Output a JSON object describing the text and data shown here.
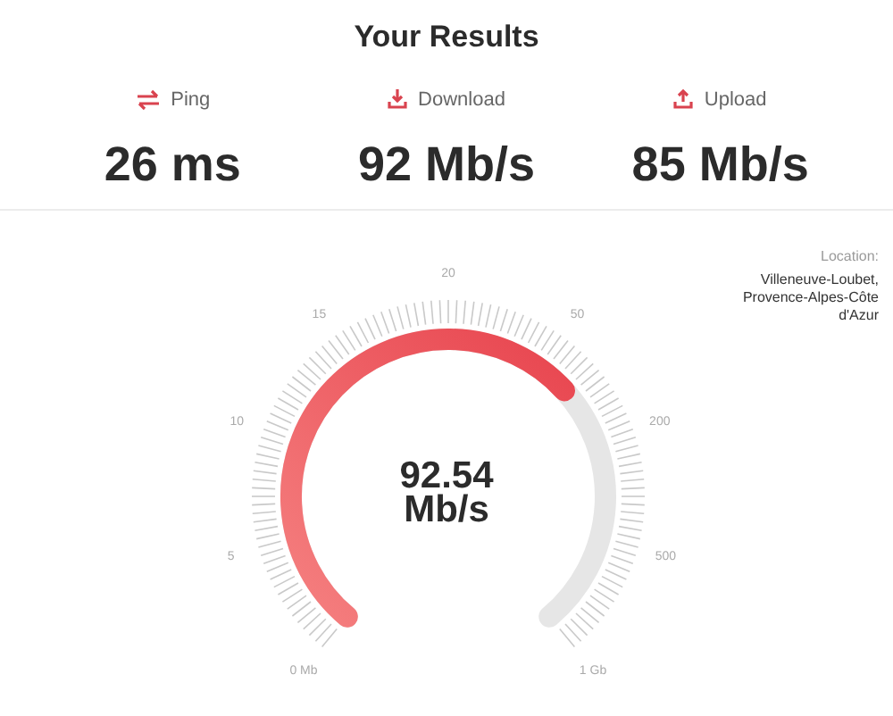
{
  "title": "Your Results",
  "metrics": [
    {
      "kind": "ping",
      "label": "Ping",
      "value": "26 ms"
    },
    {
      "kind": "download",
      "label": "Download",
      "value": "92 Mb/s"
    },
    {
      "kind": "upload",
      "label": "Upload",
      "value": "85 Mb/s"
    }
  ],
  "location": {
    "label": "Location:",
    "value": "Villeneuve-Loubet, Provence-Alpes-Côte d'Azur"
  },
  "gauge": {
    "reading": "92.54",
    "unit": "Mb/s",
    "scale_labels": [
      "0 Mb",
      "5",
      "10",
      "15",
      "20",
      "50",
      "200",
      "500",
      "1 Gb"
    ]
  }
}
